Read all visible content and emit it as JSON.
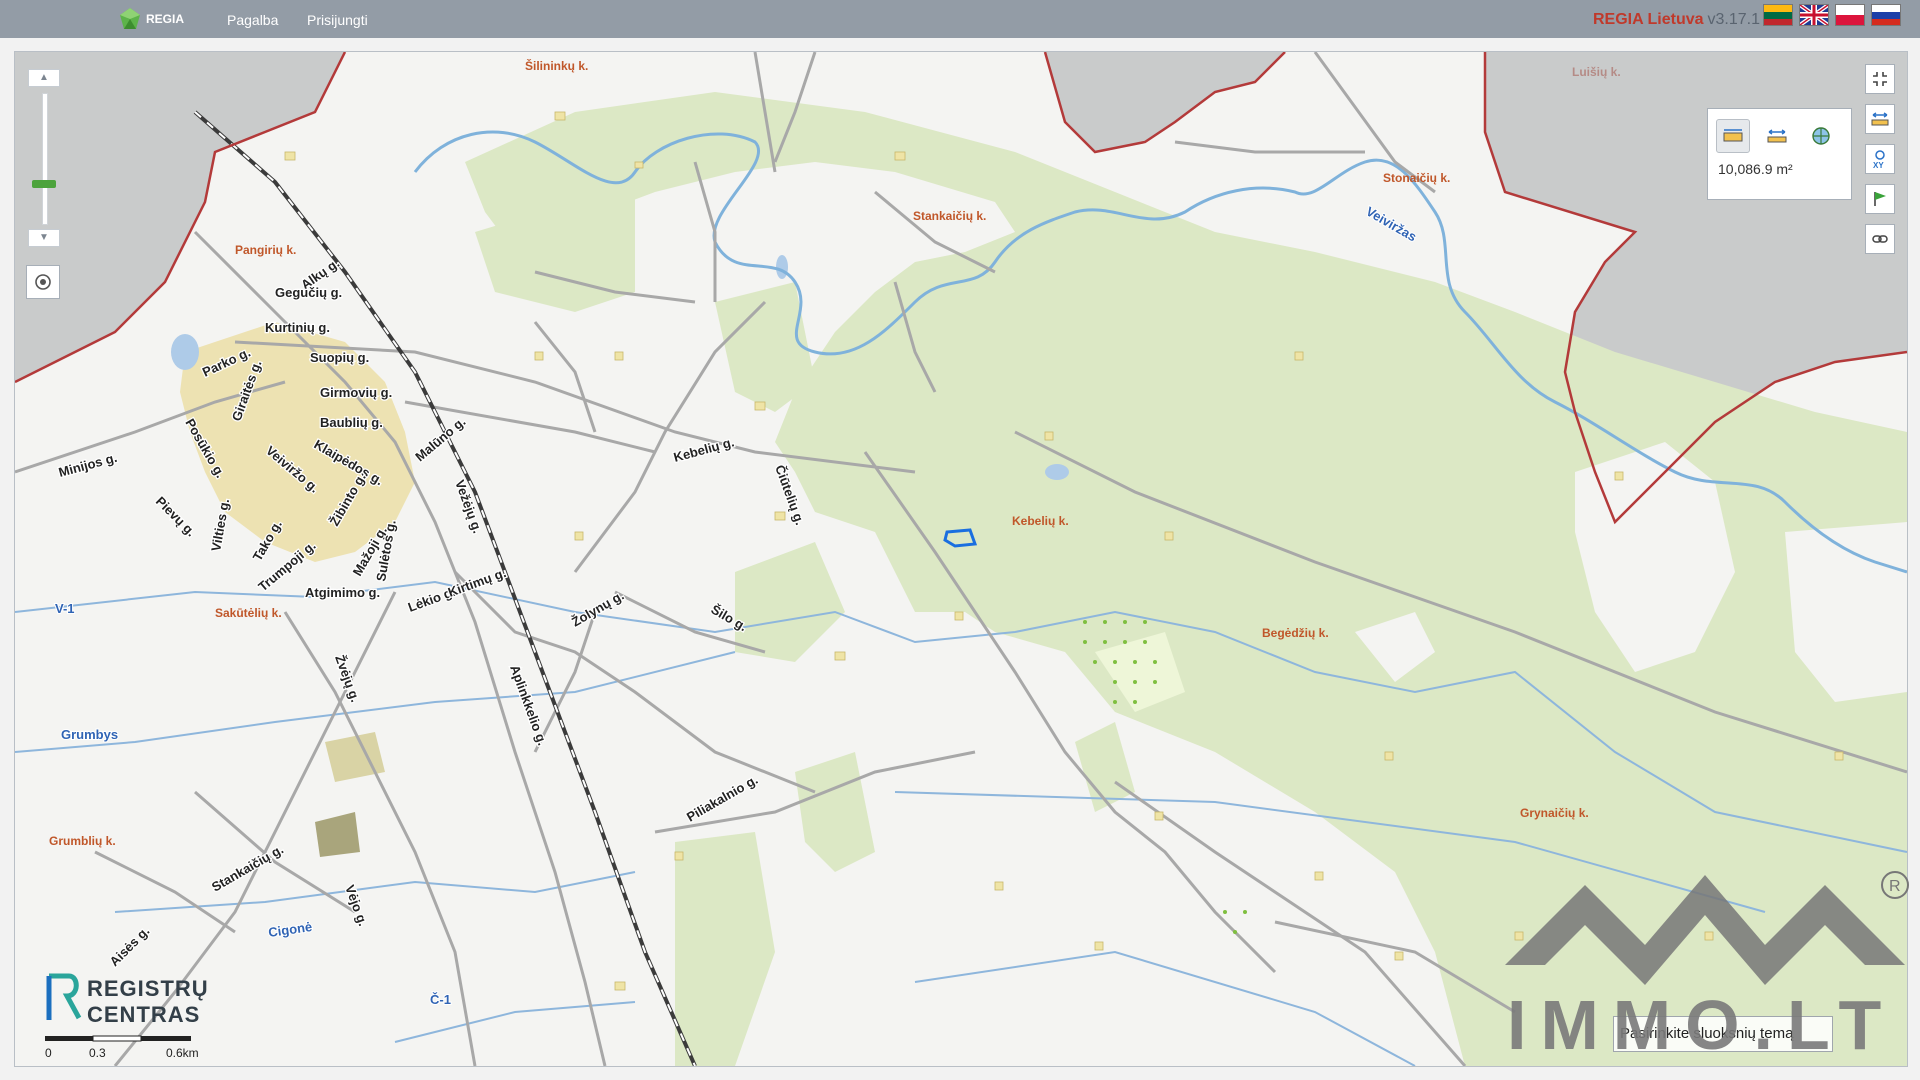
{
  "header": {
    "logo_text": "REGIA",
    "nav": [
      "Pagalba",
      "Prisijungti"
    ],
    "brand": "REGIA Lietuva",
    "version": "v3.17.1",
    "languages": [
      "lt",
      "en",
      "pl",
      "ru"
    ]
  },
  "measure": {
    "tools": [
      "area-measure",
      "distance-measure",
      "coordinates"
    ],
    "value": "10,086.9 m²"
  },
  "map": {
    "villages": [
      "Šilininkų k.",
      "Pangirių k.",
      "Stankaičių k.",
      "Stonaičių k.",
      "Luišių k.",
      "Kebelių k.",
      "Begėdžių k.",
      "Sakūtėlių k.",
      "Grumblių k.",
      "Grynaičių k."
    ],
    "streets": [
      "Alkų g.",
      "Gegučių g.",
      "Kurtinių g.",
      "Suopių g.",
      "Girmovių g.",
      "Baublių g.",
      "Klaipėdos g.",
      "Parko g.",
      "Giraitės g.",
      "Posūkio g.",
      "Minijos g.",
      "Veiviržo g.",
      "Pievų g.",
      "Vilties g.",
      "Tako g.",
      "Trumpoji g.",
      "Žibinto g.",
      "Mažoji g.",
      "Sulėtos g.",
      "Atgimimo g.",
      "Lėkio g.",
      "Kirtimų g.",
      "Vežėjų g.",
      "Malūno g.",
      "Kebelių g.",
      "Čiūtelių g.",
      "Žolynų g.",
      "Šilo g.",
      "Žvėjų g.",
      "Aplinkkelio g.",
      "Piliakalnio g.",
      "Vėjo g.",
      "Stankaičių g.",
      "Aisės g."
    ],
    "water": [
      "Veiviržas",
      "Grumbys",
      "Cigonė",
      "Č-1",
      "V-1"
    ]
  },
  "scale": [
    "0",
    "0.3",
    "0.6km"
  ],
  "registry_logo": [
    "REGISTRŲ",
    "CENTRAS"
  ],
  "watermark": "IMMO.LT",
  "layer_placeholder": "Pasirinkite sluoksnių temą"
}
